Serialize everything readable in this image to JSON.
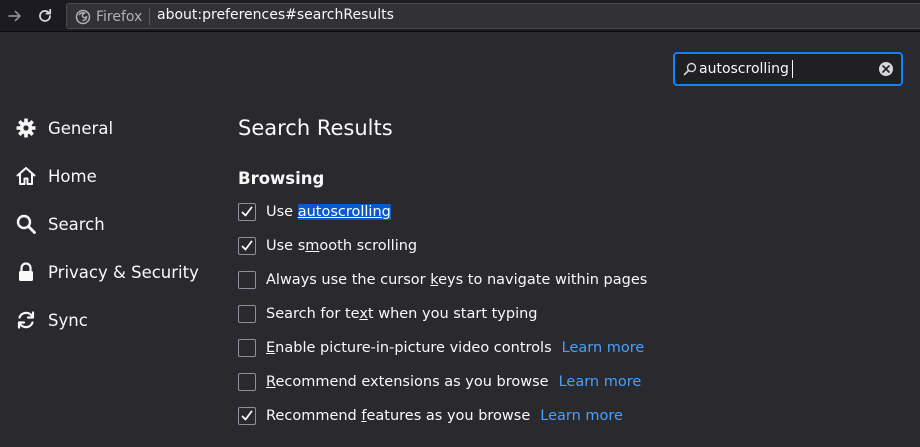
{
  "toolbar": {
    "identity_label": "Firefox",
    "url": "about:preferences#searchResults"
  },
  "search": {
    "value": "autoscrolling",
    "focused_color": "#0a84ff"
  },
  "sidebar": {
    "items": [
      {
        "label": "General",
        "icon": "gear-icon"
      },
      {
        "label": "Home",
        "icon": "home-icon"
      },
      {
        "label": "Search",
        "icon": "search-icon"
      },
      {
        "label": "Privacy & Security",
        "icon": "lock-icon"
      },
      {
        "label": "Sync",
        "icon": "sync-icon"
      }
    ]
  },
  "main": {
    "title": "Search Results",
    "section": "Browsing",
    "options": [
      {
        "pre": "Use ",
        "access": "",
        "highlight": "autoscrolling",
        "post": "",
        "checked": true
      },
      {
        "pre": "Use s",
        "access": "m",
        "post": "ooth scrolling",
        "checked": true
      },
      {
        "pre": "Always use the cursor ",
        "access": "k",
        "post": "eys to navigate within pages",
        "checked": false
      },
      {
        "pre": "Search for te",
        "access": "x",
        "post": "t when you start typing",
        "checked": false
      },
      {
        "pre": "",
        "access": "E",
        "post": "nable picture-in-picture video controls",
        "checked": false,
        "link": "Learn more"
      },
      {
        "pre": "",
        "access": "R",
        "post": "ecommend extensions as you browse",
        "checked": false,
        "link": "Learn more"
      },
      {
        "pre": "Recommend ",
        "access": "f",
        "post": "eatures as you browse",
        "checked": true,
        "link": "Learn more"
      }
    ]
  },
  "colors": {
    "background": "#2a2a2e",
    "link": "#45a1ff",
    "highlight": "#0a58d0"
  }
}
